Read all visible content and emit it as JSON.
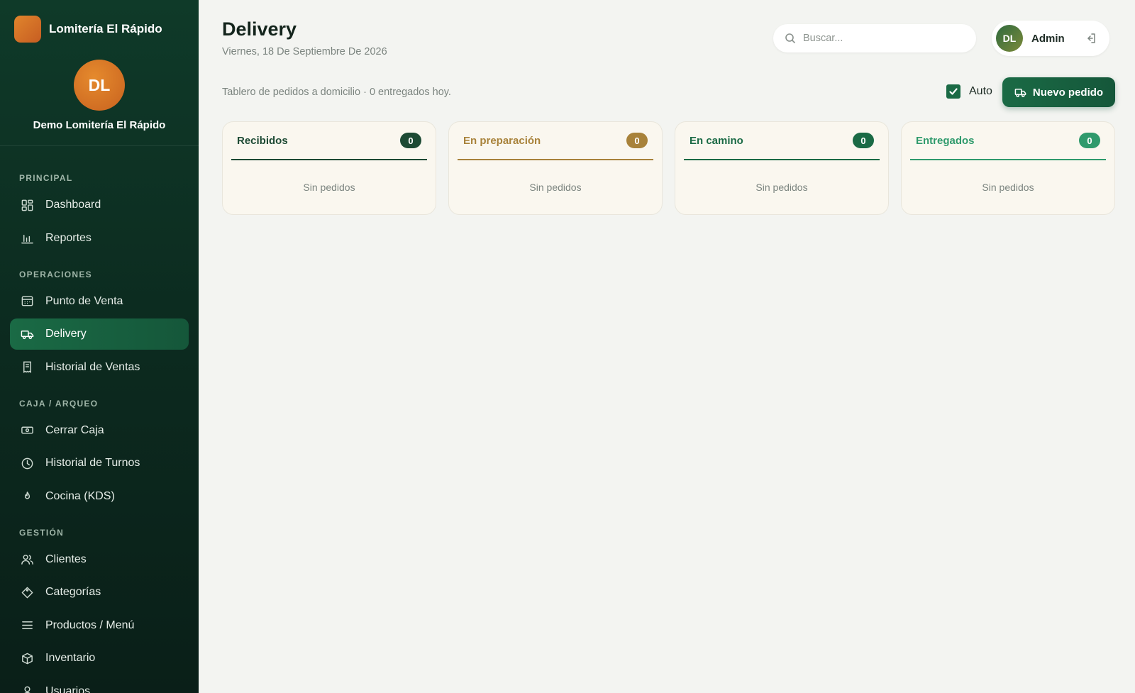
{
  "brand": {
    "name": "Lomitería El Rápido"
  },
  "profile": {
    "initials": "DL",
    "name": "Demo Lomitería El Rápido"
  },
  "sidebar": {
    "sections": [
      {
        "title": "PRINCIPAL",
        "items": [
          {
            "label": "Dashboard",
            "icon": "grid-icon"
          },
          {
            "label": "Reportes",
            "icon": "bar-chart-icon"
          }
        ]
      },
      {
        "title": "OPERACIONES",
        "items": [
          {
            "label": "Punto de Venta",
            "icon": "register-icon"
          },
          {
            "label": "Delivery",
            "icon": "truck-icon",
            "active": true
          },
          {
            "label": "Historial de Ventas",
            "icon": "receipt-icon"
          }
        ]
      },
      {
        "title": "CAJA / ARQUEO",
        "items": [
          {
            "label": "Cerrar Caja",
            "icon": "cash-icon"
          },
          {
            "label": "Historial de Turnos",
            "icon": "clock-icon"
          },
          {
            "label": "Cocina (KDS)",
            "icon": "flame-icon"
          }
        ]
      },
      {
        "title": "GESTIÓN",
        "items": [
          {
            "label": "Clientes",
            "icon": "users-icon"
          },
          {
            "label": "Categorías",
            "icon": "tag-icon"
          },
          {
            "label": "Productos / Menú",
            "icon": "menu-lines-icon"
          },
          {
            "label": "Inventario",
            "icon": "box-icon"
          },
          {
            "label": "Usuarios",
            "icon": "user-icon"
          }
        ]
      }
    ]
  },
  "header": {
    "title": "Delivery",
    "date": "Viernes, 18 De Septiembre De 2026",
    "search_placeholder": "Buscar...",
    "user_initials": "DL",
    "user_name": "Admin"
  },
  "toolbar": {
    "subtitle": "Tablero de pedidos a domicilio · 0 entregados hoy.",
    "auto_label": "Auto",
    "auto_checked": true,
    "new_order_label": "Nuevo pedido"
  },
  "columns": [
    {
      "title": "Recibidos",
      "count": "0",
      "empty": "Sin pedidos",
      "color": "#1d4a34"
    },
    {
      "title": "En preparación",
      "count": "0",
      "empty": "Sin pedidos",
      "color": "#a8823a"
    },
    {
      "title": "En camino",
      "count": "0",
      "empty": "Sin pedidos",
      "color": "#1a6a45"
    },
    {
      "title": "Entregados",
      "count": "0",
      "empty": "Sin pedidos",
      "color": "#2f9a6c"
    }
  ],
  "colors": {
    "accent": "#1a6a45",
    "sidebar": "#0f3a29",
    "brand_orange": "#e0852c"
  }
}
